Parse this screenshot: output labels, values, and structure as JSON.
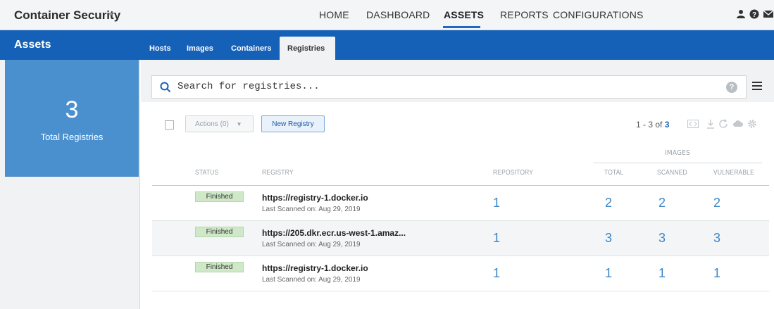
{
  "app": {
    "title": "Container Security"
  },
  "topnav": {
    "items": [
      "HOME",
      "DASHBOARD",
      "ASSETS",
      "REPORTS",
      "CONFIGURATIONS"
    ],
    "active": "ASSETS"
  },
  "section": {
    "title": "Assets",
    "tabs": [
      "Hosts",
      "Images",
      "Containers",
      "Registries"
    ],
    "active_tab": "Registries"
  },
  "stats": {
    "count": "3",
    "label": "Total Registries"
  },
  "search": {
    "placeholder": "Search for registries..."
  },
  "toolbar": {
    "actions_label": "Actions (0)",
    "new_registry_label": "New Registry",
    "pager_prefix": "1 - 3 of",
    "pager_total": "3"
  },
  "table": {
    "group_header": "IMAGES",
    "headers": {
      "status": "STATUS",
      "registry": "REGISTRY",
      "repository": "REPOSITORY",
      "total": "TOTAL",
      "scanned": "SCANNED",
      "vulnerable": "VULNERABLE"
    },
    "rows": [
      {
        "status": "Finished",
        "registry": "https://registry-1.docker.io",
        "last_scanned": "Last Scanned on: Aug 29, 2019",
        "repository": "1",
        "total": "2",
        "scanned": "2",
        "vulnerable": "2"
      },
      {
        "status": "Finished",
        "registry": "https://205.dkr.ecr.us-west-1.amaz...",
        "last_scanned": "Last Scanned on: Aug 29, 2019",
        "repository": "1",
        "total": "3",
        "scanned": "3",
        "vulnerable": "3"
      },
      {
        "status": "Finished",
        "registry": "https://registry-1.docker.io",
        "last_scanned": "Last Scanned on: Aug 29, 2019",
        "repository": "1",
        "total": "1",
        "scanned": "1",
        "vulnerable": "1"
      }
    ]
  },
  "colors": {
    "brand_blue": "#1661b8",
    "stat_blue": "#4a90cf",
    "badge_green": "#cfe8c8",
    "number_blue": "#3b86c9"
  }
}
